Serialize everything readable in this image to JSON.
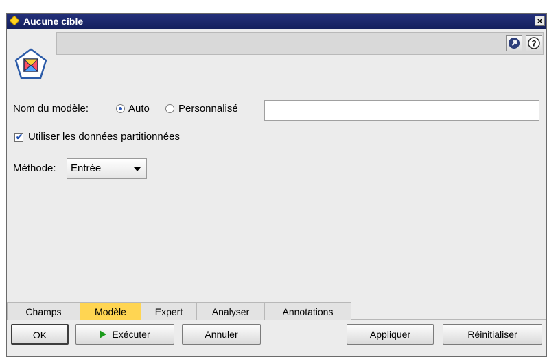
{
  "window": {
    "title": "Aucune cible",
    "close_glyph": "×"
  },
  "header": {
    "node_icon": "node-model-icon",
    "buttons": [
      {
        "icon": "launch-icon",
        "glyph": "↗"
      },
      {
        "icon": "help-icon",
        "glyph": "?"
      }
    ]
  },
  "form": {
    "model_name_label": "Nom du modèle:",
    "radio_auto": "Auto",
    "radio_custom": "Personnalisé",
    "selected_option": "Auto",
    "model_name_value": "",
    "use_partitioned_label": "Utiliser les données partitionnées",
    "use_partitioned_checked": true,
    "method_label": "Méthode:",
    "method_value": "Entrée"
  },
  "tabs": [
    "Champs",
    "Modèle",
    "Expert",
    "Analyser",
    "Annotations"
  ],
  "active_tab": "Modèle",
  "buttons": {
    "ok": "OK",
    "execute": "Exécuter",
    "cancel": "Annuler",
    "apply": "Appliquer",
    "reset": "Réinitialiser"
  },
  "colors": {
    "title_bar": "#1a2468",
    "active_tab": "#ffd552",
    "play": "#1b9b1b"
  }
}
